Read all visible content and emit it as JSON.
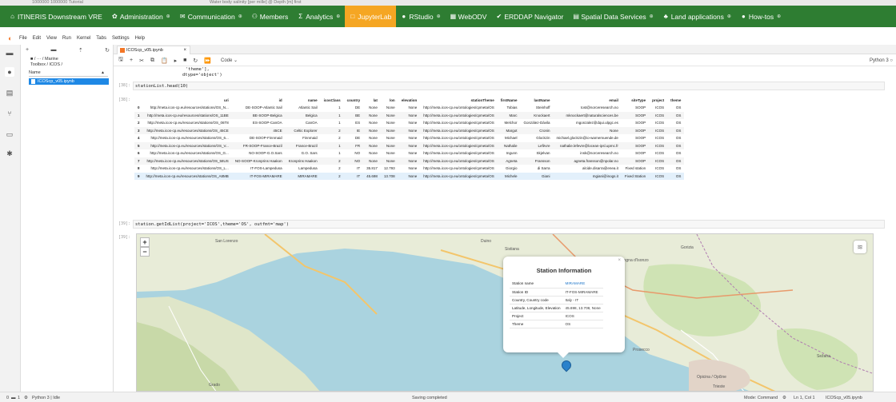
{
  "topstrip": {
    "left_text": "1000000 1000000 Tutorial",
    "right_text": "Water body salinity [per mille] @ Depth [m] first"
  },
  "navbar": {
    "items": [
      {
        "label": "ITINERIS Downstream VRE",
        "icon": "home-icon",
        "active": false,
        "caret": false
      },
      {
        "label": "Administration",
        "icon": "gear-icon",
        "active": false,
        "caret": true
      },
      {
        "label": "Communication",
        "icon": "chat-icon",
        "active": false,
        "caret": true
      },
      {
        "label": "Members",
        "icon": "users-icon",
        "active": false,
        "caret": false
      },
      {
        "label": "Analytics",
        "icon": "sigma-icon",
        "active": false,
        "caret": true
      },
      {
        "label": "JupyterLab",
        "icon": "square-icon",
        "active": true,
        "caret": false
      },
      {
        "label": "RStudio",
        "icon": "circle-icon",
        "active": false,
        "caret": true
      },
      {
        "label": "WebODV",
        "icon": "grid-icon",
        "active": false,
        "caret": false
      },
      {
        "label": "ERDDAP Navigator",
        "icon": "check-icon",
        "active": false,
        "caret": false
      },
      {
        "label": "Spatial Data Services",
        "icon": "layers-icon",
        "active": false,
        "caret": true
      },
      {
        "label": "Land applications",
        "icon": "tree-icon",
        "active": false,
        "caret": true
      },
      {
        "label": "How-tos",
        "icon": "circle-icon",
        "active": false,
        "caret": true
      }
    ],
    "colors": {
      "bar": "#2e7d32",
      "active": "#f5a623"
    }
  },
  "menubar": {
    "items": [
      "File",
      "Edit",
      "View",
      "Run",
      "Kernel",
      "Tabs",
      "Settings",
      "Help"
    ]
  },
  "filebrowser": {
    "path": "■ / ··· / Marine",
    "sub": "Toolbox / ICOS /",
    "header": "Name",
    "files": [
      "ICOScp_v05.ipynb"
    ]
  },
  "notebook": {
    "tab": "ICOScp_v05.ipynb",
    "cell_type": "Code",
    "kernel": "Python 3",
    "pre_text_1": "'theme'],",
    "pre_text_2": "dtype='object')",
    "cell1_prompt": "[38]:",
    "cell1_code": "stationList.head(10)",
    "out1_prompt": "[38]:",
    "cell2_prompt": "[39]:",
    "cell2_code": "station.getIdList(project='ICOS',theme='OS', outfmt='map')",
    "out2_prompt": "[39]:"
  },
  "table": {
    "columns": [
      "",
      "uri",
      "id",
      "name",
      "icosClass",
      "country",
      "lat",
      "lon",
      "elevation",
      "stationTheme",
      "firstName",
      "lastName",
      "email",
      "siteType",
      "project",
      "theme"
    ],
    "rows": [
      [
        "0",
        "http://meta.icos-cp.eu/resources/stations/OS_N...",
        "DE-SOOP-Atlantic Sail",
        "Atlantic Sail",
        "1",
        "DE",
        "None",
        "None",
        "None",
        "http://meta.icos-cp.eu/ontologies/cpmeta/OS",
        "Tobias",
        "Steinhoff",
        "tost@norceresearch.no",
        "SOOP",
        "ICOS",
        "OS"
      ],
      [
        "1",
        "http://meta.icos-cp.eu/resources/stations/OS_11BE",
        "BE-SOOP-Belgica",
        "Belgica",
        "1",
        "BE",
        "None",
        "None",
        "None",
        "http://meta.icos-cp.eu/ontologies/cpmeta/OS",
        "Marc",
        "Knockaert",
        "mknockaert@naturalsciences.be",
        "SOOP",
        "ICOS",
        "OS"
      ],
      [
        "2",
        "http://meta.icos-cp.eu/resources/stations/OS_06T8",
        "ES-SOOP-CanOA",
        "CanOA",
        "1",
        "ES",
        "None",
        "None",
        "None",
        "http://meta.icos-cp.eu/ontologies/cpmeta/OS",
        "Melchor",
        "González-Dávila",
        "mgonzalez@dqui.ulpgc.es",
        "SOOP",
        "ICOS",
        "OS"
      ],
      [
        "3",
        "http://meta.icos-cp.eu/resources/stations/OS_45CE",
        "45CE",
        "Celtic Explorer",
        "2",
        "IE",
        "None",
        "None",
        "None",
        "http://meta.icos-cp.eu/ontologies/cpmeta/OS",
        "Margot",
        "Cronin",
        "None",
        "SOOP",
        "ICOS",
        "OS"
      ],
      [
        "4",
        "http://meta.icos-cp.eu/resources/stations/OS_6...",
        "DE-SOOP-Finnmaid",
        "Finnmaid",
        "2",
        "DE",
        "None",
        "None",
        "None",
        "http://meta.icos-cp.eu/ontologies/cpmeta/OS",
        "Michael",
        "Glockzin",
        "michael.glockzin@io-warnemuende.de",
        "SOOP",
        "ICOS",
        "OS"
      ],
      [
        "5",
        "http://meta.icos-cp.eu/resources/stations/OS_V...",
        "FR-SOOP-France-Brazil",
        "France-Brazil",
        "1",
        "FR",
        "None",
        "None",
        "None",
        "http://meta.icos-cp.eu/ontologies/cpmeta/OS",
        "Nathalie",
        "Lefèvre",
        "nathalie.lefevre@locean-ipsl.upmc.fr",
        "SOOP",
        "ICOS",
        "OS"
      ],
      [
        "6",
        "http://meta.icos-cp.eu/resources/stations/OS_G...",
        "NO-SOOP-G.O.Sars",
        "G.O. Sars",
        "1",
        "NO",
        "None",
        "None",
        "None",
        "http://meta.icos-cp.eu/ontologies/cpmeta/OS",
        "Ingunn",
        "Skjelvan",
        "insk@norceresearch.no",
        "SOOP",
        "ICOS",
        "OS"
      ],
      [
        "7",
        "http://meta.icos-cp.eu/resources/stations/OS_58US",
        "NO-SOOP-Kronprins Haakon",
        "Kronprins Haakon",
        "2",
        "NO",
        "None",
        "None",
        "None",
        "http://meta.icos-cp.eu/ontologies/cpmeta/OS",
        "Agneta",
        "Fransson",
        "agneta.fransson@npolar.no",
        "SOOP",
        "ICOS",
        "OS"
      ],
      [
        "8",
        "http://meta.icos-cp.eu/resources/stations/OS_L...",
        "IT-FOS-Lampedusa",
        "Lampedusa",
        "2",
        "IT",
        "35.817",
        "12.793",
        "None",
        "http://meta.icos-cp.eu/ontologies/cpmeta/OS",
        "Giorgio",
        "di Sarra",
        "alcide.disarra@enea.it",
        "Fixed station",
        "ICOS",
        "OS"
      ],
      [
        "9",
        "http://meta.icos-cp.eu/resources/stations/OS_A8MB",
        "IT-FOS-MIRAMARE",
        "MIRAMARE",
        "2",
        "IT",
        "45.698",
        "13.708",
        "None",
        "http://meta.icos-cp.eu/ontologies/cpmeta/OS",
        "Michele",
        "Giani",
        "mgiani@inogs.it",
        "Fixed Station",
        "ICOS",
        "OS"
      ]
    ]
  },
  "map": {
    "labels": [
      "San Lorenzo",
      "Duino",
      "Sistiana",
      "Gorizia",
      "Savogna d'Isonzo",
      "Prosecco",
      "Opicina / Opčine",
      "Sežana",
      "Grado",
      "Trieste"
    ],
    "zoom_in": "+",
    "zoom_out": "−",
    "colors": {
      "sea": "#aad3df",
      "land": "#e8ecd8",
      "marker": "#2b82cb"
    }
  },
  "popup": {
    "title": "Station Information",
    "close": "×",
    "rows": [
      {
        "label": "Station name",
        "value": "MIRAMARE",
        "link": true
      },
      {
        "label": "Station ID",
        "value": "IT-FOS-MIRAMARE",
        "link": false
      },
      {
        "label": "Country, Country code",
        "value": "Italy - IT",
        "link": false
      },
      {
        "label": "Latitude, Longitude, Elevation",
        "value": "45.698, 13.708, None",
        "link": false
      },
      {
        "label": "Project",
        "value": "ICOS",
        "link": false
      },
      {
        "label": "Theme",
        "value": "OS",
        "link": false
      }
    ]
  },
  "statusbar": {
    "left_count_1": "0",
    "left_count_2": "1",
    "kernel": "Python 3 | Idle",
    "center": "Saving completed",
    "mode": "Mode: Command",
    "position": "Ln 1, Col 1",
    "file": "ICOScp_v05.ipynb"
  }
}
